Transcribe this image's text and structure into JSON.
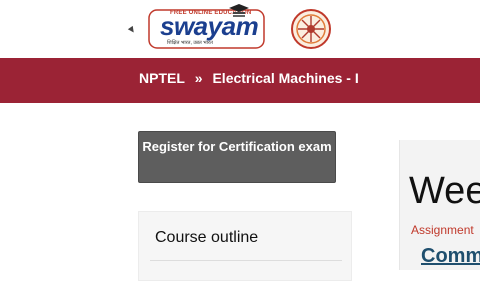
{
  "header": {
    "swayam": {
      "tagline": "FREE ONLINE EDUCATION",
      "wordmark": "swayam",
      "subtitle": "शिक्षित भारत, उन्नत भारत"
    }
  },
  "navbar": {
    "crumbs": [
      "NPTEL",
      "»",
      "Electrical Machines - I"
    ],
    "color": "#9b2335"
  },
  "main": {
    "register_button": "Register for Certification exam",
    "outline_title": "Course outline"
  },
  "right_panel": {
    "heading": "Wee",
    "assignment_link": "Assignment",
    "comm_link": "Comm"
  },
  "colors": {
    "brand_red": "#9b2335",
    "swayam_blue": "#1b3f8f",
    "button_gray": "#5e5e5e"
  }
}
